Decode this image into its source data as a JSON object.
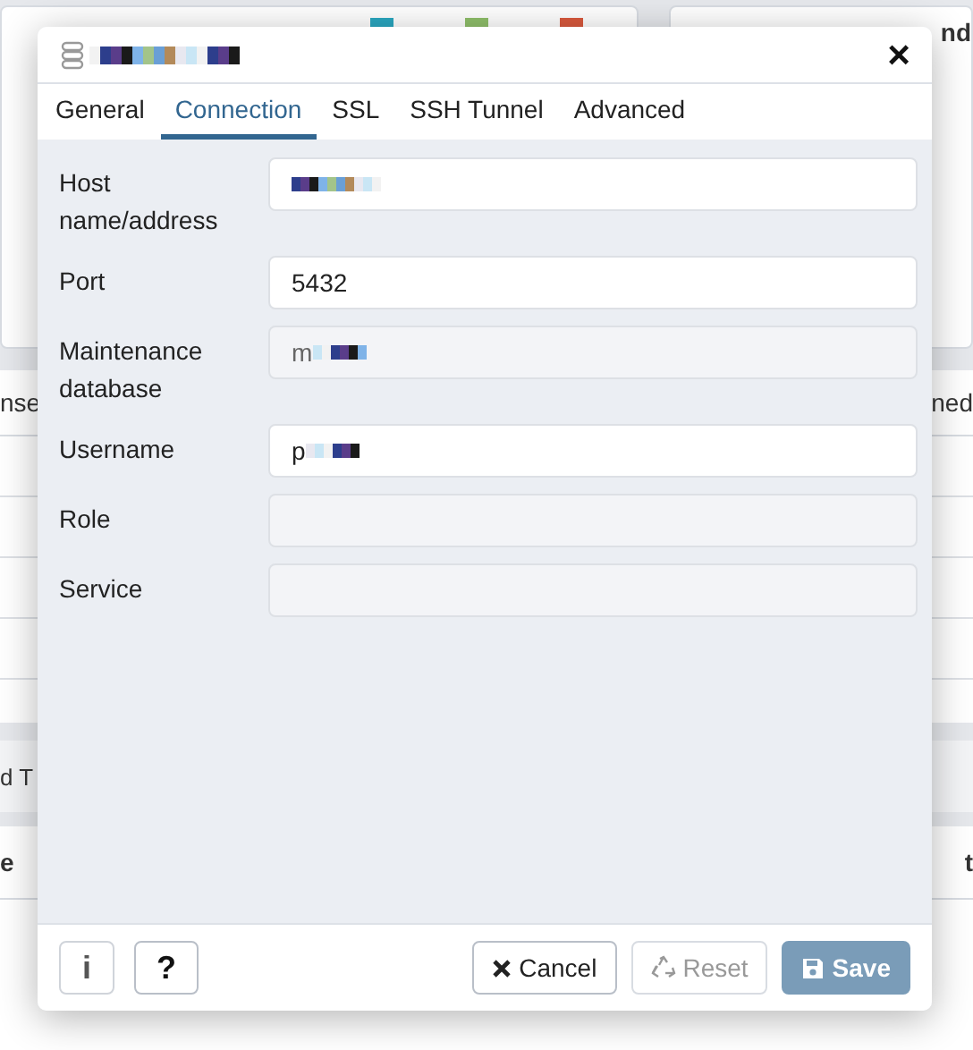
{
  "background": {
    "top_header": "nd",
    "legend": [
      {
        "color": "#2aa7c0"
      },
      {
        "color": "#8fbf6a"
      },
      {
        "color": "#d9593d"
      }
    ],
    "section_left": "nse",
    "section_right": "ned",
    "section_title": "d T",
    "table_left": "e",
    "table_right": "t"
  },
  "dialog": {
    "title": {
      "redacted": true
    },
    "close": "×",
    "tabs": [
      {
        "label": "General",
        "selected": false
      },
      {
        "label": "Connection",
        "selected": true
      },
      {
        "label": "SSL",
        "selected": false
      },
      {
        "label": "SSH Tunnel",
        "selected": false
      },
      {
        "label": "Advanced",
        "selected": false
      }
    ],
    "fields": [
      {
        "label": "Host name/address",
        "redacted": true,
        "readonly": false
      },
      {
        "label": "Port",
        "value": "5432",
        "redacted": false,
        "readonly": false
      },
      {
        "label": "Maintenance database",
        "value": "m",
        "redacted": true,
        "readonly": true
      },
      {
        "label": "Username",
        "value": "p",
        "redacted": true,
        "readonly": false
      },
      {
        "label": "Role",
        "redacted": false,
        "readonly": true
      },
      {
        "label": "Service",
        "redacted": false,
        "readonly": true
      }
    ],
    "footer": {
      "info": "i",
      "help": "?",
      "buttons": [
        {
          "kind": "cancel",
          "label": "Cancel",
          "disabled": false
        },
        {
          "kind": "reset",
          "label": "Reset",
          "disabled": true
        },
        {
          "kind": "save",
          "label": "Save",
          "disabled": true
        }
      ]
    }
  }
}
